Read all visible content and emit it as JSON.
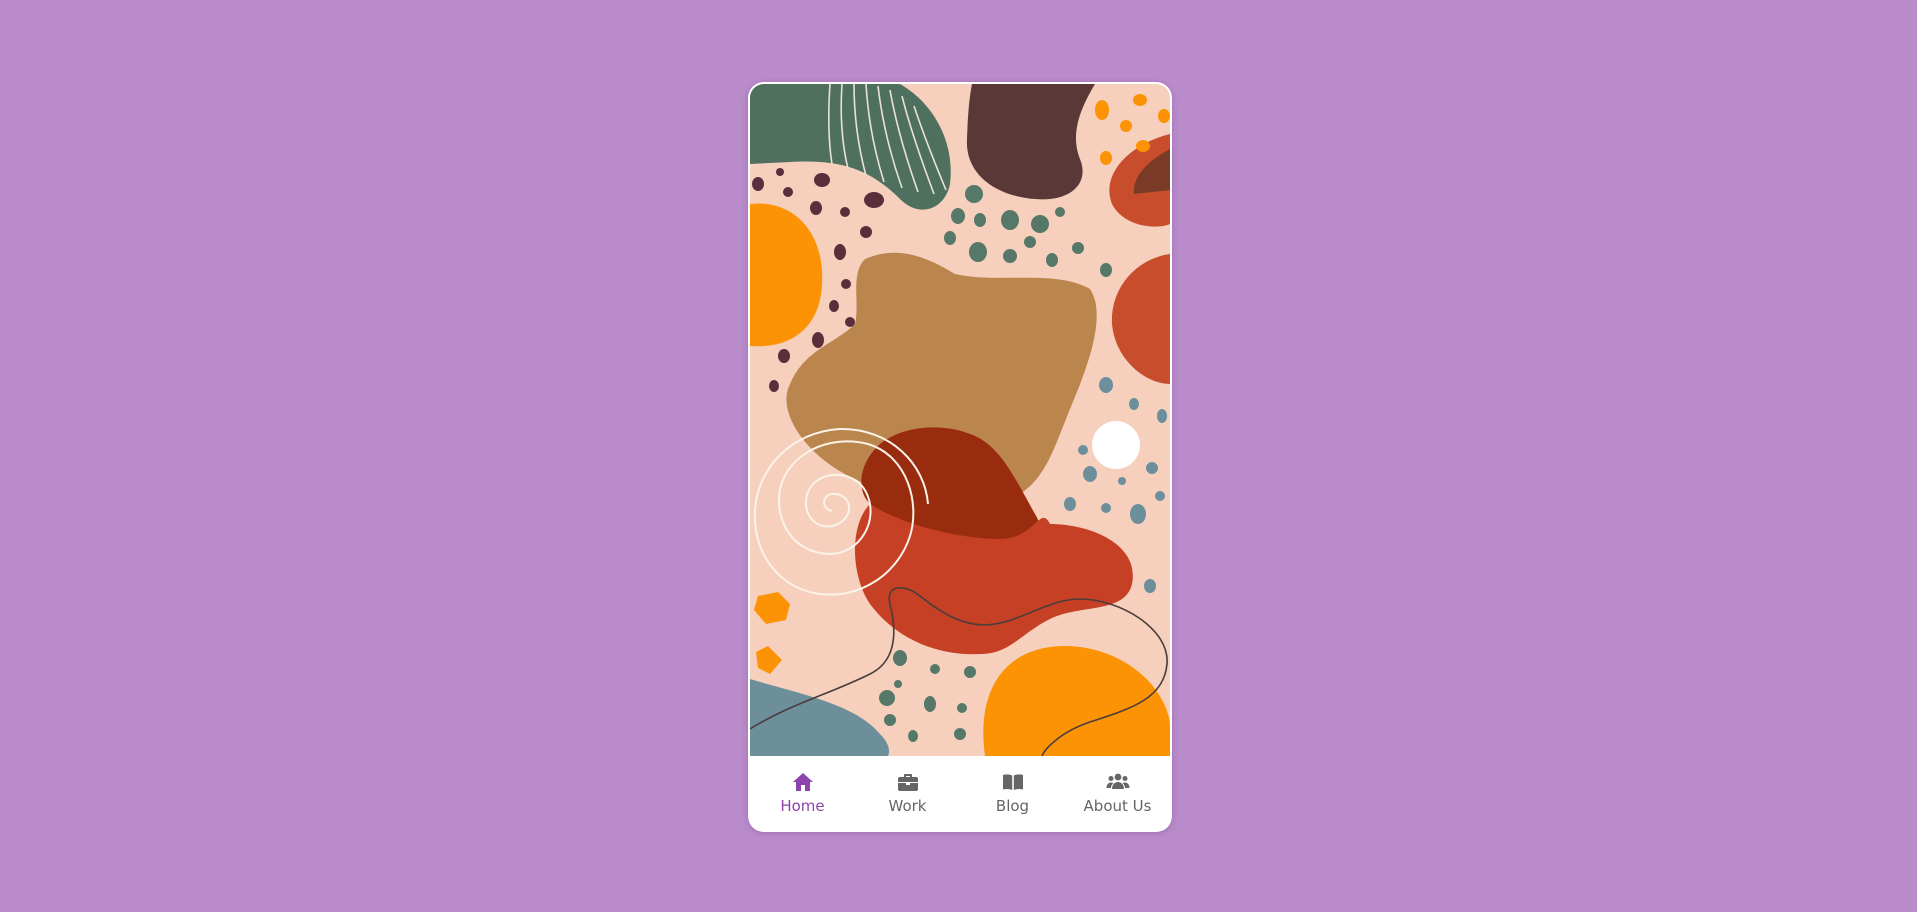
{
  "colors": {
    "page_background": "#b98bcb",
    "active": "#8e44ad",
    "inactive": "#666666",
    "art_base": "#f6d0bd"
  },
  "hero": {
    "image": "abstract-organic-shapes-artwork"
  },
  "bottom_nav": {
    "active_index": 0,
    "items": [
      {
        "label": "Home",
        "icon": "home-icon"
      },
      {
        "label": "Work",
        "icon": "briefcase-icon"
      },
      {
        "label": "Blog",
        "icon": "book-icon"
      },
      {
        "label": "About Us",
        "icon": "users-icon"
      }
    ]
  }
}
